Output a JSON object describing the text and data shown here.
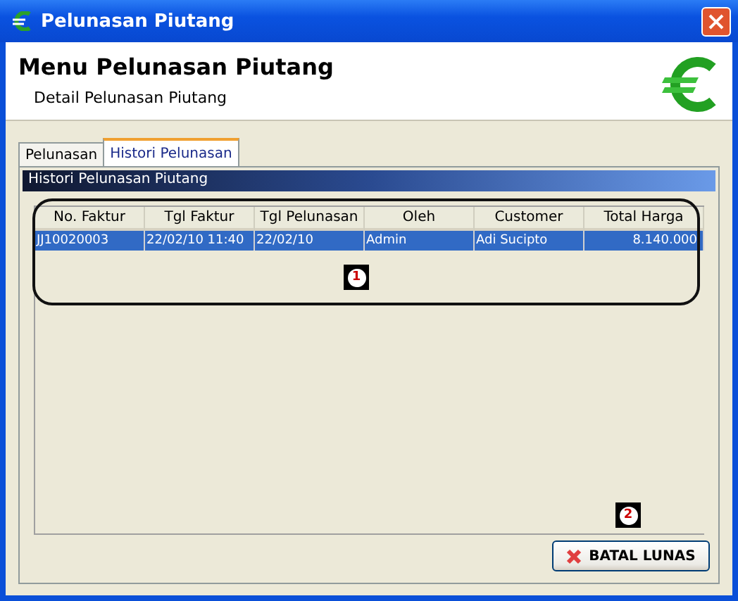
{
  "window": {
    "title": "Pelunasan Piutang"
  },
  "header": {
    "title": "Menu Pelunasan Piutang",
    "subtitle": "Detail Pelunasan Piutang"
  },
  "tabs": [
    {
      "label": "Pelunasan",
      "selected": false
    },
    {
      "label": "Histori Pelunasan",
      "selected": true
    }
  ],
  "panel": {
    "title": "Histori Pelunasan Piutang"
  },
  "table": {
    "columns": [
      "No. Faktur",
      "Tgl Faktur",
      "Tgl Pelunasan",
      "Oleh",
      "Customer",
      "Total Harga"
    ],
    "rows": [
      {
        "cells": [
          "JJ10020003",
          "22/02/10 11:40",
          "22/02/10",
          "Admin",
          "Adi Sucipto",
          "8.140.000"
        ],
        "selected": true
      }
    ]
  },
  "annotations": [
    "1",
    "2"
  ],
  "buttons": [
    {
      "label": "BATAL LUNAS"
    }
  ]
}
